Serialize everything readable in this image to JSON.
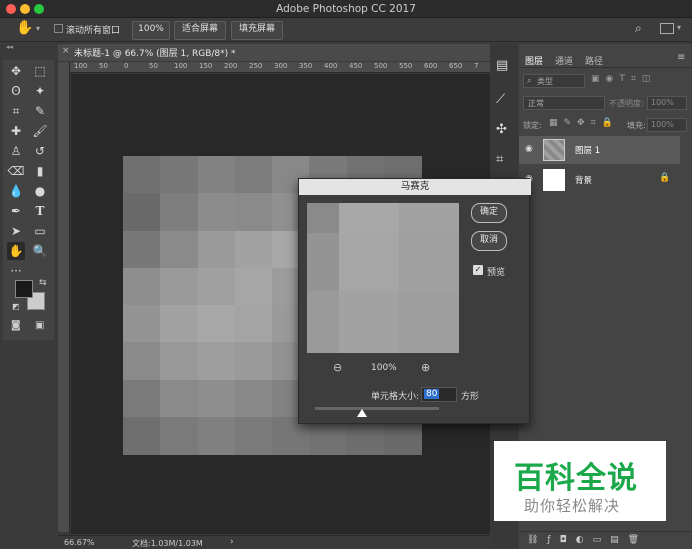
{
  "app": {
    "title": "Adobe Photoshop CC 2017"
  },
  "options": {
    "scroll_all": "滚动所有窗口",
    "zoom": "100%",
    "fit": "适合屏幕",
    "fill": "填充屏幕"
  },
  "document": {
    "tab": "未标题-1 @ 66.7% (图层 1, RGB/8*) *"
  },
  "ruler": {
    "top_ticks": [
      "100",
      "50",
      "0",
      "50",
      "100",
      "150",
      "200",
      "250",
      "300",
      "350",
      "400",
      "450",
      "500",
      "550",
      "600",
      "650",
      "7"
    ]
  },
  "status": {
    "zoom": "66.67%",
    "doc": "文档:1.03M/1.03M"
  },
  "layers": {
    "tabs": [
      "图层",
      "通道",
      "路径"
    ],
    "filter": "类型",
    "blend": "正常",
    "opacity_label": "不透明度:",
    "opacity_value": "100%",
    "lock_label": "锁定:",
    "fill_label": "填充:",
    "fill_value": "100%",
    "items": [
      {
        "name": "图层 1"
      },
      {
        "name": "背景"
      }
    ]
  },
  "dialog": {
    "title": "马赛克",
    "ok": "确定",
    "cancel": "取消",
    "preview_label": "预览",
    "preview_checked": true,
    "zoom": "100%",
    "cell_size_label": "单元格大小:",
    "cell_size_value": "80",
    "unit": "方形"
  },
  "watermark": {
    "title": "百科全说",
    "subtitle": "助你轻松解决"
  },
  "mosaic_grays": [
    [
      "#707070",
      "#787878",
      "#828282",
      "#7c7c7c",
      "#888888",
      "#7a7a7a",
      "#727272",
      "#6e6e6e"
    ],
    [
      "#6a6a6a",
      "#7e7e7e",
      "#8c8c8c",
      "#8a8a8a",
      "#909090",
      "#848484",
      "#7a7a7a",
      "#707070"
    ],
    [
      "#787878",
      "#8a8a8a",
      "#9a9a9a",
      "#a2a2a2",
      "#a8a8a8",
      "#969696",
      "#8a8a8a",
      "#7c7c7c"
    ],
    [
      "#8e8e8e",
      "#9a9a9a",
      "#a0a0a0",
      "#a6a6a6",
      "#9c9c9c",
      "#a0a0a0",
      "#929292",
      "#868686"
    ],
    [
      "#949494",
      "#a2a2a2",
      "#a8a8a8",
      "#a4a4a4",
      "#9a9a9a",
      "#989898",
      "#8c8c8c",
      "#7e7e7e"
    ],
    [
      "#8a8a8a",
      "#989898",
      "#9e9e9e",
      "#9a9a9a",
      "#929292",
      "#8a8a8a",
      "#848484",
      "#787878"
    ],
    [
      "#7a7a7a",
      "#8a8a8a",
      "#8e8e8e",
      "#888888",
      "#828282",
      "#7c7c7c",
      "#767676",
      "#707070"
    ],
    [
      "#6e6e6e",
      "#7a7a7a",
      "#808080",
      "#7a7a7a",
      "#767676",
      "#727272",
      "#6e6e6e",
      "#6a6a6a"
    ]
  ],
  "preview_grays": [
    [
      "#8a8a8a",
      "#a8a8a8",
      "#a2a2a2",
      "#9a9a9a"
    ],
    [
      "#949494",
      "#a6a6a6",
      "#a0a0a0",
      "#969696"
    ],
    [
      "#9a9a9a",
      "#a2a2a2",
      "#9e9e9e",
      "#929292"
    ],
    [
      "#8e8e8e",
      "#9a9a9a",
      "#969696",
      "#8c8c8c"
    ]
  ]
}
